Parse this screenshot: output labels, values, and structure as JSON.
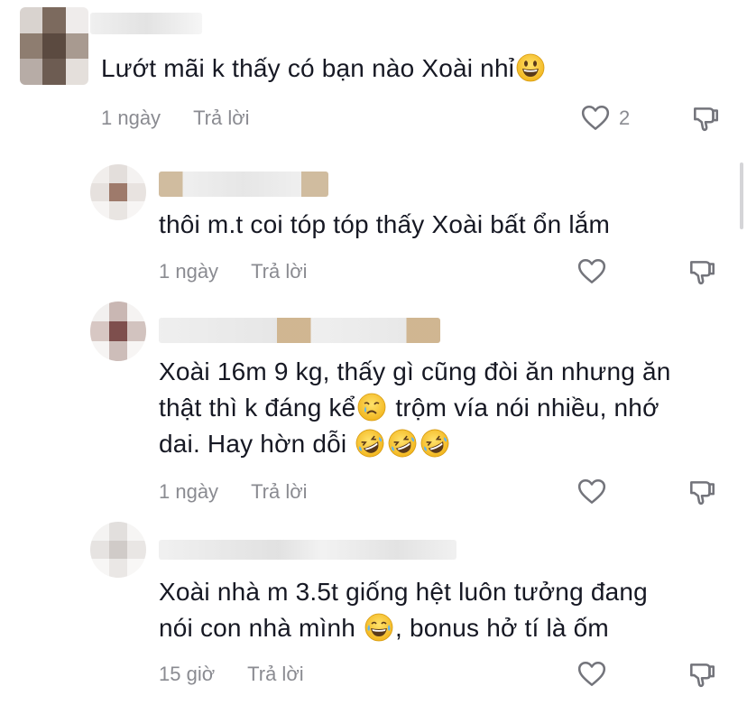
{
  "comments": [
    {
      "text": "Lướt mãi k thấy có bạn nào Xoài nhỉ",
      "time": "1 ngày",
      "reply_label": "Trả lời",
      "like_count": "2",
      "emoji_icon": "grinning-face-icon"
    },
    {
      "text": "thôi m.t coi tóp tóp thấy Xoài bất ổn lắm",
      "time": "1 ngày",
      "reply_label": "Trả lời"
    },
    {
      "text_line1": "Xoài 16m 9 kg, thấy gì cũng đòi ăn nhưng ăn",
      "text_line2a": "thật thì k đáng kể",
      "text_line2b": " trộm vía nói nhiều, nhớ",
      "text_line3": "dai. Hay hờn dỗi ",
      "time": "1 ngày",
      "reply_label": "Trả lời",
      "emoji_icons": [
        "crying-face-icon",
        "rofl-icon"
      ]
    },
    {
      "text_line1": "Xoài nhà m 3.5t giống hệt luôn tưởng đang",
      "text_line2a": "nói con nhà mình ",
      "text_line2b": ", bonus hở tí là ốm",
      "time": "15 giờ",
      "reply_label": "Trả lời",
      "emoji_icon": "tears-of-joy-icon"
    }
  ],
  "colors": {
    "text": "#161823",
    "meta": "#8a8b91",
    "emoji_yellow": "#f7c52a"
  }
}
